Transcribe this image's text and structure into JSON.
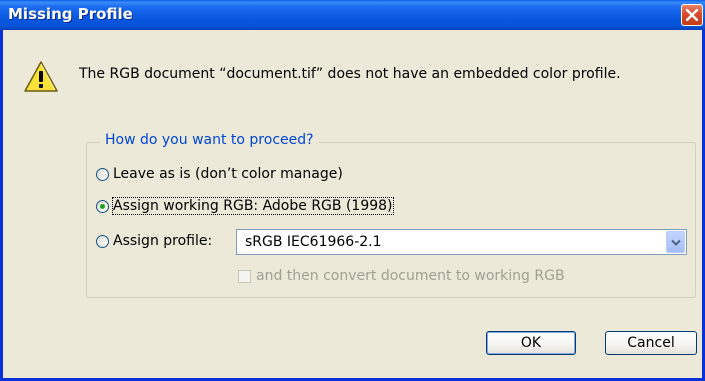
{
  "window": {
    "title": "Missing Profile"
  },
  "message": "The RGB document “document.tif” does not have an embedded color profile.",
  "group": {
    "legend": "How do you want to proceed?",
    "options": [
      {
        "label": "Leave as is (don’t color manage)",
        "selected": false
      },
      {
        "label": "Assign working RGB:  Adobe RGB (1998)",
        "selected": true
      },
      {
        "label": "Assign profile:",
        "selected": false
      }
    ],
    "profile_select": {
      "value": "sRGB IEC61966-2.1"
    },
    "convert_checkbox": {
      "label": "and then convert document to working RGB",
      "checked": false,
      "disabled": true
    }
  },
  "buttons": {
    "ok": "OK",
    "cancel": "Cancel"
  },
  "colors": {
    "titlebar": "#0a5fe8",
    "legend": "#0046d5",
    "window_bg": "#ece9d8"
  },
  "icons": [
    "warning-icon",
    "close-icon",
    "chevron-down-icon"
  ]
}
